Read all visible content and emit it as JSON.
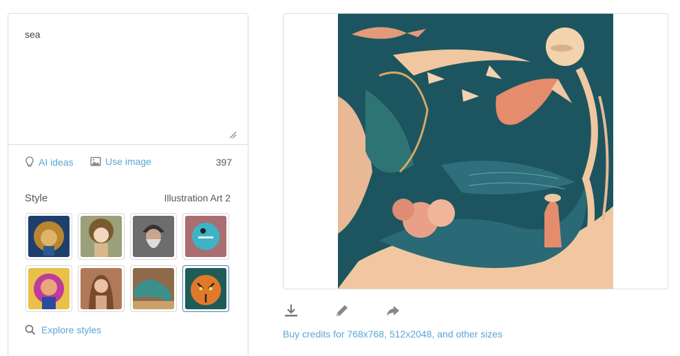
{
  "prompt": {
    "value": "sea"
  },
  "tools": {
    "ai_ideas_label": "AI ideas",
    "use_image_label": "Use image",
    "char_count": "397"
  },
  "style": {
    "label": "Style",
    "selected_name": "Illustration Art 2"
  },
  "explore_label": "Explore styles",
  "buy_credits_label": "Buy credits for 768x768, 512x2048, and other sizes",
  "icons": {
    "ideas": "lightbulb-icon",
    "image": "image-icon",
    "search": "search-icon",
    "download": "download-icon",
    "edit": "pencil-icon",
    "share": "share-arrow-icon"
  },
  "colors": {
    "accent": "#5aa5d6",
    "selected_border": "#4a7fb0",
    "art_background": "#1c5560",
    "art_cream": "#f2cfae"
  }
}
